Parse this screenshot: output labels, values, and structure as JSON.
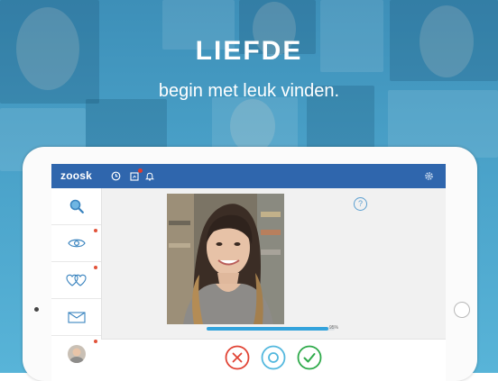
{
  "promo": {
    "headline": "LIEFDE",
    "subline": "begin met leuk vinden."
  },
  "app": {
    "logo": "zoosk",
    "topbar_icons": [
      "clock-icon",
      "carousel-icon",
      "bell-icon",
      "gear-icon"
    ],
    "sidebar_items": [
      {
        "icon": "search-icon",
        "new": false
      },
      {
        "icon": "eye-icon",
        "new": true
      },
      {
        "icon": "hearts-icon",
        "new": true
      },
      {
        "icon": "mail-icon",
        "new": false
      },
      {
        "icon": "avatar",
        "new": true
      }
    ],
    "progress_percent": 95,
    "progress_label": "95%",
    "help_label": "?"
  },
  "colors": {
    "topbar": "#2f66ad",
    "progress": "#33a3dc",
    "no": "#e14334",
    "maybe": "#53b8de",
    "yes": "#2eaa4a"
  }
}
